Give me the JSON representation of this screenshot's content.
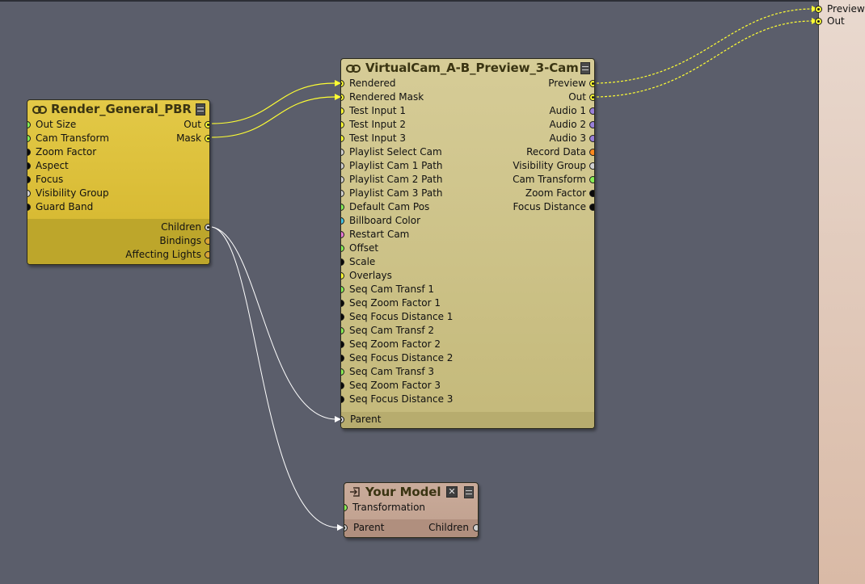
{
  "colors": {
    "canvas": "#5b5e6b",
    "render_node": "#dcc23c",
    "virtualcam_node": "#cfc58e",
    "model_node": "#c4a594",
    "wire_yellow": "#ffff33",
    "wire_white": "#ffffff",
    "pin_yellow": "#ffff33",
    "pin_green": "#88f055",
    "pin_black": "#0a0a0a",
    "pin_gray": "#d2d2d2",
    "pin_purple": "#9a80d8",
    "pin_orange": "#ff8a1e",
    "pin_cyan": "#44c6e6",
    "pin_pink": "#ee7ad9",
    "pin_gold": "#d9a436"
  },
  "icons": {
    "link": "link-icon",
    "menu": "node-menu-icon",
    "close": "close-icon",
    "input": "input-arrow-icon"
  },
  "external_outputs": [
    {
      "label": "Preview"
    },
    {
      "label": "Out"
    }
  ],
  "render_node": {
    "title": "Render_General_PBR",
    "inputs": [
      {
        "label": "Out Size",
        "pin": "pin_green"
      },
      {
        "label": "Cam Transform",
        "pin": "pin_green"
      },
      {
        "label": "Zoom Factor",
        "pin": "pin_black"
      },
      {
        "label": "Aspect",
        "pin": "pin_black"
      },
      {
        "label": "Focus",
        "pin": "pin_black"
      },
      {
        "label": "Visibility Group",
        "pin": "pin_gray"
      },
      {
        "label": "Guard Band",
        "pin": "pin_black"
      }
    ],
    "outputs": [
      {
        "label": "Out",
        "pin": "pin_yellow",
        "connected": true
      },
      {
        "label": "Mask",
        "pin": "pin_yellow",
        "connected": true
      }
    ],
    "hierarchy": [
      {
        "label": "Children",
        "pin": "pin_gray",
        "connected": true
      },
      {
        "label": "Bindings",
        "pin": "pin_gold"
      },
      {
        "label": "Affecting Lights",
        "pin": "pin_gold"
      }
    ]
  },
  "virtualcam_node": {
    "title": "VirtualCam_A-B_Preview_3-Cam",
    "inputs": [
      {
        "label": "Rendered",
        "pin": "pin_yellow",
        "connected": true
      },
      {
        "label": "Rendered Mask",
        "pin": "pin_yellow",
        "connected": true
      },
      {
        "label": "Test Input 1",
        "pin": "pin_yellow"
      },
      {
        "label": "Test Input 2",
        "pin": "pin_yellow"
      },
      {
        "label": "Test Input 3",
        "pin": "pin_yellow"
      },
      {
        "label": "Playlist Select Cam",
        "pin": "pin_gray"
      },
      {
        "label": "Playlist Cam 1 Path",
        "pin": "pin_gray"
      },
      {
        "label": "Playlist Cam 2 Path",
        "pin": "pin_gray"
      },
      {
        "label": "Playlist Cam 3 Path",
        "pin": "pin_gray"
      },
      {
        "label": "Default Cam Pos",
        "pin": "pin_green"
      },
      {
        "label": "Billboard Color",
        "pin": "pin_cyan"
      },
      {
        "label": "Restart Cam",
        "pin": "pin_pink"
      },
      {
        "label": "Offset",
        "pin": "pin_green"
      },
      {
        "label": "Scale",
        "pin": "pin_black"
      },
      {
        "label": "Overlays",
        "pin": "pin_yellow"
      },
      {
        "label": "Seq Cam Transf 1",
        "pin": "pin_green"
      },
      {
        "label": "Seq Zoom Factor 1",
        "pin": "pin_black"
      },
      {
        "label": "Seq Focus Distance 1",
        "pin": "pin_black"
      },
      {
        "label": "Seq Cam Transf 2",
        "pin": "pin_green"
      },
      {
        "label": "Seq Zoom Factor 2",
        "pin": "pin_black"
      },
      {
        "label": "Seq Focus Distance 2",
        "pin": "pin_black"
      },
      {
        "label": "Seq Cam Transf 3",
        "pin": "pin_green"
      },
      {
        "label": "Seq Zoom Factor 3",
        "pin": "pin_black"
      },
      {
        "label": "Seq Focus Distance 3",
        "pin": "pin_black"
      }
    ],
    "outputs": [
      {
        "label": "Preview",
        "pin": "pin_yellow",
        "connected": true
      },
      {
        "label": "Out",
        "pin": "pin_yellow",
        "connected": true
      },
      {
        "label": "Audio 1",
        "pin": "pin_purple"
      },
      {
        "label": "Audio 2",
        "pin": "pin_purple"
      },
      {
        "label": "Audio 3",
        "pin": "pin_purple"
      },
      {
        "label": "Record Data",
        "pin": "pin_orange"
      },
      {
        "label": "Visibility Group",
        "pin": "pin_gray"
      },
      {
        "label": "Cam Transform",
        "pin": "pin_green"
      },
      {
        "label": "Zoom Factor",
        "pin": "pin_black"
      },
      {
        "label": "Focus Distance",
        "pin": "pin_black"
      }
    ],
    "parent": {
      "label": "Parent",
      "pin": "pin_gray",
      "connected": true
    }
  },
  "model_node": {
    "title": "Your Model",
    "inputs": [
      {
        "label": "Transformation",
        "pin": "pin_green"
      }
    ],
    "parent": {
      "label": "Parent",
      "pin": "pin_gray",
      "connected": true
    },
    "children": {
      "label": "Children",
      "pin": "pin_gray"
    }
  }
}
